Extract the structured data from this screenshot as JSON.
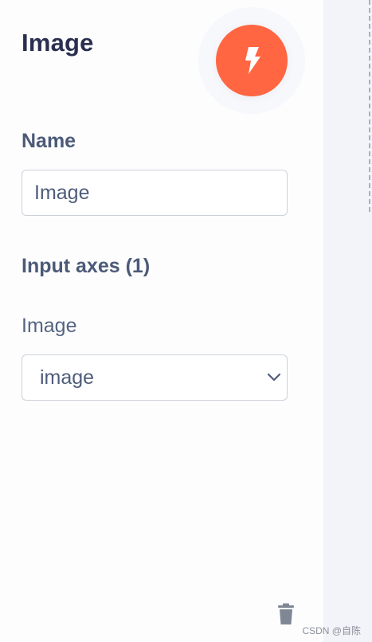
{
  "panel": {
    "title": "Image",
    "action_button_icon": "lightning-bolt-icon",
    "accent_color": "#ff6641"
  },
  "name_section": {
    "label": "Name",
    "input_value": "Image"
  },
  "input_axes": {
    "label": "Input axes (1)",
    "field_label": "Image",
    "selected_value": "image",
    "dropdown_icon": "chevron-down-icon"
  },
  "footer": {
    "delete_icon": "trash-icon"
  },
  "watermark": "CSDN @自陈"
}
